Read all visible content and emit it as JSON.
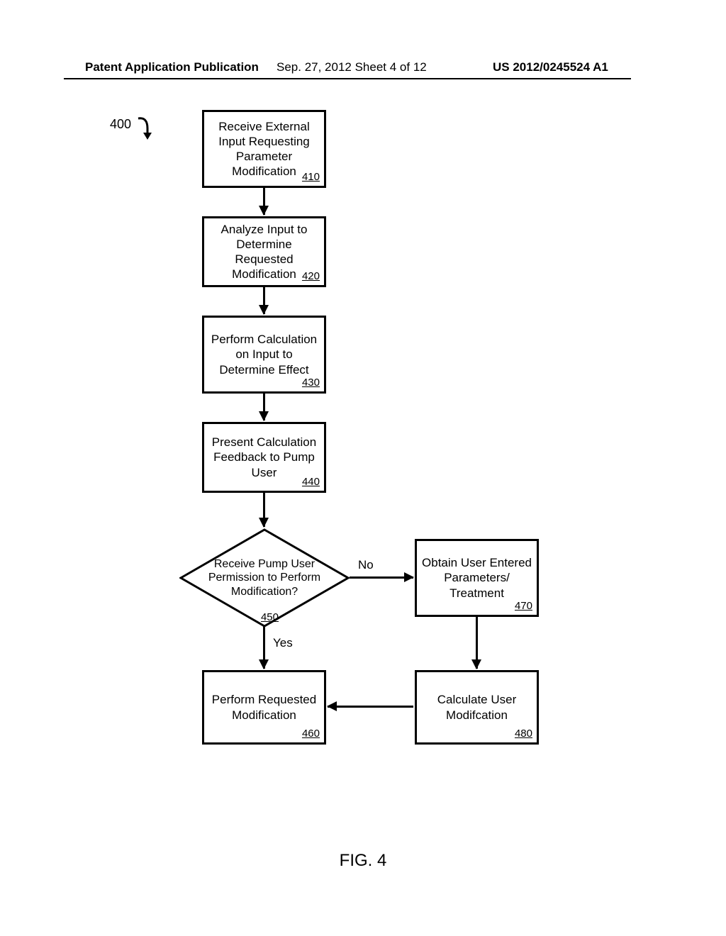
{
  "header": {
    "left": "Patent Application Publication",
    "mid": "Sep. 27, 2012  Sheet 4 of 12",
    "right": "US 2012/0245524 A1"
  },
  "flow_label": "400",
  "boxes": {
    "b410": {
      "text": "Receive External Input Requesting Parameter Modification",
      "ref": "410"
    },
    "b420": {
      "text": "Analyze Input to Determine Requested Modification",
      "ref": "420"
    },
    "b430": {
      "text": "Perform Calculation on Input to Determine Effect",
      "ref": "430"
    },
    "b440": {
      "text": "Present Calculation Feedback to Pump User",
      "ref": "440"
    },
    "d450": {
      "text": "Receive Pump User Permission to Perform Modification?",
      "ref": "450"
    },
    "b460": {
      "text": "Perform Requested Modification",
      "ref": "460"
    },
    "b470": {
      "text": "Obtain User Entered Parameters/ Treatment",
      "ref": "470"
    },
    "b480": {
      "text": "Calculate User Modifcation",
      "ref": "480"
    }
  },
  "edges": {
    "yes": "Yes",
    "no": "No"
  },
  "figure": "FIG. 4",
  "chart_data": {
    "type": "flowchart",
    "nodes": [
      {
        "id": "410",
        "type": "process",
        "label": "Receive External Input Requesting Parameter Modification"
      },
      {
        "id": "420",
        "type": "process",
        "label": "Analyze Input to Determine Requested Modification"
      },
      {
        "id": "430",
        "type": "process",
        "label": "Perform Calculation on Input to Determine Effect"
      },
      {
        "id": "440",
        "type": "process",
        "label": "Present Calculation Feedback to Pump User"
      },
      {
        "id": "450",
        "type": "decision",
        "label": "Receive Pump User Permission to Perform Modification?"
      },
      {
        "id": "460",
        "type": "process",
        "label": "Perform Requested Modification"
      },
      {
        "id": "470",
        "type": "process",
        "label": "Obtain User Entered Parameters/Treatment"
      },
      {
        "id": "480",
        "type": "process",
        "label": "Calculate User Modifcation"
      }
    ],
    "edges": [
      {
        "from": "410",
        "to": "420"
      },
      {
        "from": "420",
        "to": "430"
      },
      {
        "from": "430",
        "to": "440"
      },
      {
        "from": "440",
        "to": "450"
      },
      {
        "from": "450",
        "to": "460",
        "label": "Yes"
      },
      {
        "from": "450",
        "to": "470",
        "label": "No"
      },
      {
        "from": "470",
        "to": "480"
      },
      {
        "from": "480",
        "to": "460"
      }
    ],
    "entry_label": "400",
    "title": "FIG. 4"
  }
}
